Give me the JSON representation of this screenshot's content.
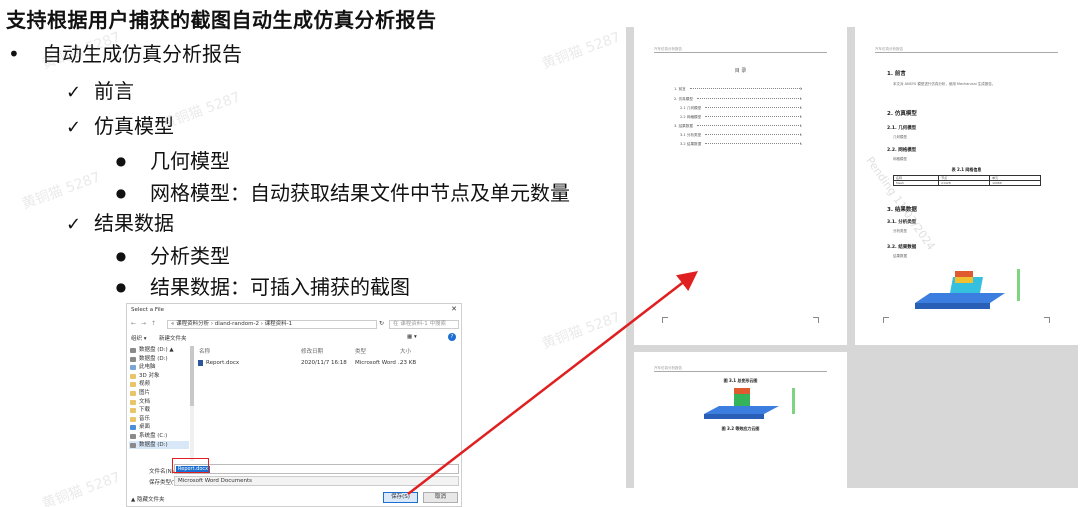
{
  "slide": {
    "title": "支持根据用户捕获的截图自动生成仿真分析报告",
    "bullet_main": "自动生成仿真分析报告",
    "items": [
      {
        "label": "前言"
      },
      {
        "label": "仿真模型"
      },
      {
        "label": "几何模型"
      },
      {
        "label": "网格模型：自动获取结果文件中节点及单元数量"
      },
      {
        "label": "结果数据"
      },
      {
        "label": "分析类型"
      },
      {
        "label": "结果数据：可插入捕获的截图"
      }
    ],
    "watermark": "黄铜猫 5287"
  },
  "dialog": {
    "title": "Select a File",
    "breadcrumb": "« 课程资料分析 › diand-random-2 › 课程资料-1",
    "search_placeholder": "在 课程资料-1 中搜索",
    "toolbar": {
      "organize": "组织 ▾",
      "new_folder": "新建文件夹"
    },
    "nav_items": [
      {
        "label": "数据盘 (D:) ▲",
        "icon": "drive-icon"
      },
      {
        "label": "数据盘 (D:)",
        "icon": "drive-icon"
      },
      {
        "label": "此电脑",
        "icon": "computer-icon"
      },
      {
        "label": "3D 对象",
        "icon": "folder-icon"
      },
      {
        "label": "视频",
        "icon": "folder-icon"
      },
      {
        "label": "图片",
        "icon": "folder-icon"
      },
      {
        "label": "文档",
        "icon": "folder-icon"
      },
      {
        "label": "下载",
        "icon": "folder-icon"
      },
      {
        "label": "音乐",
        "icon": "folder-icon"
      },
      {
        "label": "桌面",
        "icon": "folder-icon"
      },
      {
        "label": "系统盘 (C:)",
        "icon": "drive-icon"
      },
      {
        "label": "数据盘 (D:)",
        "icon": "drive-icon"
      }
    ],
    "columns": [
      "名称",
      "修改日期",
      "类型",
      "大小"
    ],
    "files": [
      {
        "name": "Report.docx",
        "modified": "2020/11/7 16:18",
        "type": "Microsoft Word ...",
        "size": "23 KB"
      }
    ],
    "file_name_label": "文件名(N):",
    "file_name_value": "Report.docx",
    "file_type_label": "保存类型(T):",
    "file_type_value": "Microsoft Word Documents",
    "hide_folders": "▲ 隐藏文件夹",
    "save_button": "保存(S)",
    "cancel_button": "取消"
  },
  "report": {
    "header_text": "汽车仿真分析报告",
    "toc_title": "目 录",
    "toc_entries": [
      {
        "num": "1.",
        "label": "前言",
        "page": "1"
      },
      {
        "num": "2.",
        "label": "仿真模型",
        "page": "1"
      },
      {
        "num": "2.1",
        "label": "几何模型",
        "page": "1"
      },
      {
        "num": "2.2",
        "label": "网格模型",
        "page": "1"
      },
      {
        "num": "3.",
        "label": "结果数据",
        "page": "1"
      },
      {
        "num": "3.1",
        "label": "分析类型",
        "page": "1"
      },
      {
        "num": "3.2",
        "label": "结果数据",
        "page": "1"
      }
    ],
    "page2": {
      "h1": "1. 前言",
      "intro": "本文对 ANSYS 模型进行仿真分析，使用 Mechanical 生成报告。",
      "h2": "2. 仿真模型",
      "h21": "2.1. 几何模型",
      "h21_text": "几何模型",
      "h22": "2.2. 网格模型",
      "h22_text": "网格模型",
      "table_caption": "表 2.1 网格信息",
      "table_headers": [
        "名称",
        "节点",
        "单元"
      ],
      "table_rows": [
        [
          "Mesh",
          "21428",
          "10988"
        ]
      ],
      "h3": "3. 结果数据",
      "h31": "3.1. 分析类型",
      "h31_text": "分析类型",
      "h32": "3.2. 结果数据",
      "h32_text": "结果数据"
    },
    "page3": {
      "fig1_caption": "图 3.1 总变形云图",
      "fig2_caption": "图 3.2 等效应力云图"
    },
    "watermark": "Pending 11/07/2024"
  }
}
